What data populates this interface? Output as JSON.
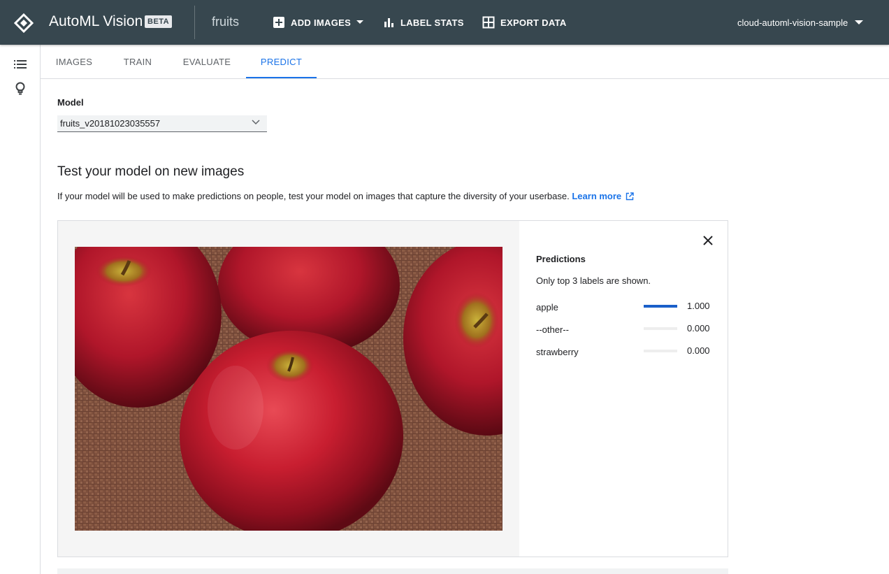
{
  "header": {
    "app_title": "AutoML Vision",
    "beta_badge": "BETA",
    "dataset_name": "fruits",
    "add_images_label": "ADD IMAGES",
    "label_stats_label": "LABEL STATS",
    "export_data_label": "EXPORT DATA",
    "project_name": "cloud-automl-vision-sample",
    "bar_color": "#37474f"
  },
  "sidebar": {
    "icons": [
      "list-icon",
      "lightbulb-icon"
    ]
  },
  "tabs": [
    {
      "label": "IMAGES",
      "active": false
    },
    {
      "label": "TRAIN",
      "active": false
    },
    {
      "label": "EVALUATE",
      "active": false
    },
    {
      "label": "PREDICT",
      "active": true
    }
  ],
  "model": {
    "label": "Model",
    "selected": "fruits_v20181023035557"
  },
  "test_section": {
    "title": "Test your model on new images",
    "description": "If your model will be used to make predictions on people, test your model on images that capture the diversity of your userbase.",
    "learn_more": "Learn more"
  },
  "predictions": {
    "title": "Predictions",
    "subtitle": "Only top 3 labels are shown.",
    "items": [
      {
        "label": "apple",
        "score": "1.000",
        "fraction": 1.0
      },
      {
        "label": "--other--",
        "score": "0.000",
        "fraction": 0.0
      },
      {
        "label": "strawberry",
        "score": "0.000",
        "fraction": 0.0
      }
    ]
  },
  "accent_color": "#1a73e8"
}
